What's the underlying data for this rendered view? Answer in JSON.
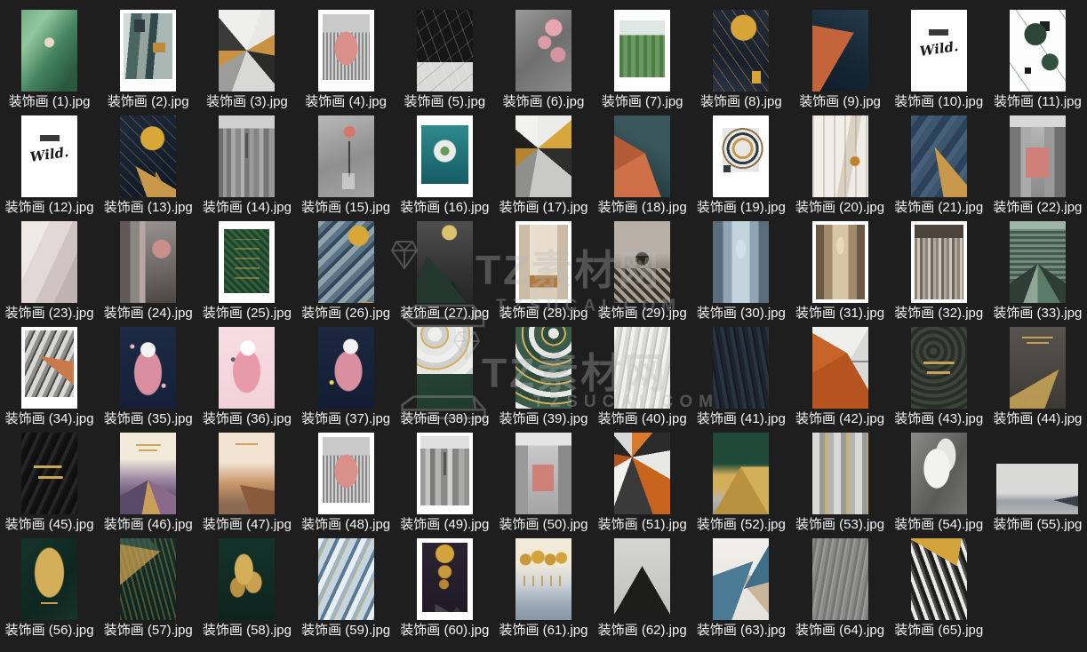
{
  "theme": {
    "background": "#1e1e1e",
    "label_color": "#f5f5f5"
  },
  "watermark": {
    "brand": "TZ素材网",
    "domain": "TZSUCAI.COM"
  },
  "items": [
    {
      "label": "装饰画 (1).jpg",
      "art": "radial-gradient(circle at 50% 40%, #ecd9c8 0 5px, rgba(0,0,0,0) 6px), linear-gradient(125deg,#6fae85,#93c79e 25%,#45845f 55%,#2a5940 85%)"
    },
    {
      "label": "装饰画 (2).jpg",
      "frame": true,
      "pad": "4px 4px 14px 4px",
      "art": "linear-gradient(#c08a3e,#c08a3e) 80% 52%/14px 11px no-repeat, linear-gradient(#2f3b3d,#2f3b3d) 28% 12%/12px 14px no-repeat, linear-gradient(95deg,#d3dbd8 0 14%,#4a6663 14% 34%,#93a49f 34% 50%,#32494b 50% 64%,#a9b8b2 64% 100%)"
    },
    {
      "label": "装饰画 (3).jpg",
      "art": "conic-gradient(from 20deg at 50% 50%, #e8e8e6 0 40deg, #c99142 40deg 80deg, #2b2b29 80deg 120deg, #d8d8d6 120deg 180deg, #9c9c9a 180deg 220deg, #c99142 220deg 250deg, #3a3a38 250deg 300deg, #efefed 300deg 360deg)"
    },
    {
      "label": "装饰画 (4).jpg",
      "frame": true,
      "pad": "5px 5px 13px 5px",
      "art": "radial-gradient(ellipse at 50% 52%, #d98f8a 0 34%, rgba(0,0,0,0) 35%), linear-gradient(#c9c9c9 0 28%, rgba(0,0,0,0) 28%), repeating-linear-gradient(90deg,#8a8a8a 0 2px,#cfcfcf 2px 4px)"
    },
    {
      "label": "装饰画 (5).jpg",
      "art": "repeating-linear-gradient(70deg, rgba(255,255,255,0.22) 0 1px, rgba(0,0,0,0) 1px 12px), repeating-linear-gradient(-40deg, rgba(120,120,120,0.35) 0 1px, rgba(0,0,0,0) 1px 15px), linear-gradient(#161616 0 64%, #dadad8 64%)"
    },
    {
      "label": "装饰画 (6).jpg",
      "art": "radial-gradient(circle at 68% 22%, #e8a7b0 0 9px, rgba(0,0,0,0) 10px), radial-gradient(circle at 52% 40%, #de9aa6 0 7px, rgba(0,0,0,0) 8px), radial-gradient(circle at 76% 55%, #d393a0 0 8px, rgba(0,0,0,0) 9px), linear-gradient(140deg,#9a9a9a,#6f6f6f 50%,#8c8c8c)"
    },
    {
      "label": "装饰画 (7).jpg",
      "frame": true,
      "pad": "12px 6px 16px 6px",
      "art": "linear-gradient(#dfe7e2 0 26%, rgba(0,0,0,0) 26%), repeating-linear-gradient(90deg,#4e7d49 0 4px,#699a5f 4px 9px)"
    },
    {
      "label": "装饰画 (8).jpg",
      "art": "radial-gradient(circle at 55% 22%, #d8a437 0 14px, rgba(0,0,0,0) 15px), linear-gradient(#d8a437,#d8a437) 82% 88%/10px 14px no-repeat, repeating-linear-gradient(55deg, rgba(201,145,66,0.5) 0 1px, rgba(0,0,0,0) 1px 10px), linear-gradient(200deg,#232c3a,#18202c 60%,#2a3446)"
    },
    {
      "label": "装饰画 (9).jpg",
      "art": "conic-gradient(from 210deg at 74% 28%, #c4643a 0 70deg, rgba(0,0,0,0) 70deg), linear-gradient(205deg,#24394a,#152734 55%,#0f1d28)"
    },
    {
      "label": "装饰画 (10).jpg",
      "frame": true,
      "pad": "4px",
      "thumb_text": "Wild.",
      "text_size": 15,
      "art": "linear-gradient(#3a3a3a,#3a3a3a) 50% 24%/40% 7px no-repeat, linear-gradient(#fff,#fff)"
    },
    {
      "label": "装饰画 (11).jpg",
      "art": "radial-gradient(circle at 46% 30%, #2c4538 0 12px, rgba(0,0,0,0) 13px), linear-gradient(#202020,#202020) 66% 16%/11px 11px no-repeat, radial-gradient(circle at 72% 64%, #31503f 0 9px, rgba(0,0,0,0) 10px), linear-gradient(#161616,#161616) 30% 76%/7px 7px no-repeat, repeating-linear-gradient(55deg, rgba(0,0,0,0) 0 18px, #9fb3ab 18px 19px, rgba(0,0,0,0) 19px 40px), linear-gradient(#fdfdfd,#fdfdfd)"
    },
    {
      "label": "装饰画 (12).jpg",
      "frame": true,
      "pad": "4px",
      "thumb_text": "Wild.",
      "text_size": 15,
      "art": "linear-gradient(#3a3a3a,#3a3a3a) 50% 24%/40% 7px no-repeat, linear-gradient(#fff,#fff)"
    },
    {
      "label": "装饰画 (13).jpg",
      "art": "radial-gradient(circle at 58% 28%, #d9a738 0 13px, rgba(0,0,0,0) 14px), conic-gradient(from 120deg at 28% 62%, #c9984a 0 40deg, rgba(0,0,0,0) 40deg), conic-gradient(from 150deg at 64% 68%, #b8863b 0 35deg, rgba(0,0,0,0) 35deg), repeating-linear-gradient(45deg, rgba(201,152,74,0.35) 0 1px, rgba(0,0,0,0) 1px 9px), linear-gradient(150deg,#1d2a3c,#141f2e 60%,#0e1826)"
    },
    {
      "label": "装饰画 (14).jpg",
      "art": "linear-gradient(#555,#555) 50% 32%/3px 28px no-repeat, linear-gradient(#cfcfcf 0 16%, rgba(0,0,0,0) 16%), linear-gradient(90deg,#6e6e6e 0 8%,#999 8% 14%,#777 14% 22%,#a8a8a8 22% 30%,#8a8a8a 30% 40%,#b0b0b0 40% 46%,#787878 46% 55%,#9b9b9b 55% 63%,#858585 63% 72%,#ababab 72% 80%,#757575 80% 90%,#989898 90%)"
    },
    {
      "label": "装饰画 (15).jpg",
      "art": "radial-gradient(circle at 56% 20%, #d4766b 0 6px, rgba(0,0,0,0) 7px), linear-gradient(rgba(255,255,255,0.45),rgba(255,255,255,0.45)) 56% 88%/14px 18px no-repeat, linear-gradient(#3f3f3f,#3f3f3f) 56% 55%/2px 40px no-repeat, linear-gradient(160deg,#b9b9b9,#8f8f8f 55%,#a5a5a5)"
    },
    {
      "label": "装饰画 (16).jpg",
      "frame": true,
      "pad": "11px 5px 15px 5px",
      "art": "radial-gradient(circle at 50% 44%, #6a9a58 0 5px, #e9ece8 5px 12px, rgba(0,0,0,0) 13px), linear-gradient(#2f8a8d,#1f6f74 60%,#175c63)"
    },
    {
      "label": "装饰画 (17).jpg",
      "art": "conic-gradient(from 0deg at 40% 40%, #ececea 0 50deg, #d9a63c 50deg 90deg, #2e2e2c 90deg 130deg, #c9c9c7 130deg 190deg, #8f8f8d 190deg 230deg, #b5842f 230deg 270deg, #1f1f1d 270deg 310deg, #f2f2f0 310deg)"
    },
    {
      "label": "装饰画 (18).jpg",
      "art": "conic-gradient(from 160deg at 55% 46%, #d07048 0 80deg, #b35a36 80deg 140deg, rgba(0,0,0,0) 140deg), linear-gradient(210deg,#3a565b 0 35%,#274247 70%,#1d3338)"
    },
    {
      "label": "装饰画 (19).jpg",
      "frame": true,
      "pad": "5px 5px 14px 5px",
      "art": "radial-gradient(circle at 54% 44%, rgba(0,0,0,0) 0 9px, #c9984a 9px 12px, rgba(0,0,0,0) 12px 15px, #2e3b3c 15px 18px, rgba(0,0,0,0) 18px 21px, #88724a 21px 23px, rgba(0,0,0,0) 23px), linear-gradient(#2e3b3c,#2e3b3c) 14% 78%/8px 8px no-repeat, linear-gradient(rgba(120,120,118,0.18),rgba(120,120,118,0.18)) 50% 40%/78% 68% no-repeat, linear-gradient(#fff,#fff)"
    },
    {
      "label": "装饰画 (20).jpg",
      "art": "radial-gradient(circle at 76% 56%, #c2812f 0 5px, rgba(0,0,0,0) 6px), repeating-linear-gradient(90deg, rgba(150,140,120,0.35) 0 2px, rgba(0,0,0,0) 2px 12px), linear-gradient(100deg,#f2efe9 0 55%,#d9d2c4 55% 70%,#efece6 70%)"
    },
    {
      "label": "装饰画 (21).jpg",
      "art": "conic-gradient(from 140deg at 42% 38%, #c9984a 0 30deg, rgba(0,0,0,0) 30deg), conic-gradient(from 160deg at 70% 76%, #c9984a 0 35deg, rgba(0,0,0,0) 35deg), repeating-linear-gradient(125deg, #3d566e 0 8px, #2c415a 8px 16px, #46607a 16px 22px)"
    },
    {
      "label": "装饰画 (22).jpg",
      "art": "linear-gradient(#d8d8d8 0 14%, rgba(0,0,0,0) 14%), linear-gradient(#cf8079,#cf8079) 50% 62%/26px 34px no-repeat, linear-gradient(90deg,#777 0 20%,#aaa 20% 38%, rgba(0,0,0,0) 38% 62%, #999 62% 80%, #6f6f6f 80%), linear-gradient(#bdbdbd,#8a8a8a)"
    },
    {
      "label": "装饰画 (23).jpg",
      "art": "conic-gradient(from 230deg at 0% 35%, #cd6a42 0 50deg, rgba(0,0,0,0) 50deg), linear-gradient(115deg,#efe9e6 0 30%,#e2d9d6 30% 55%,#cfc4c2 55% 75%,#bfb3b1 75%)"
    },
    {
      "label": "装饰画 (24).jpg",
      "art": "radial-gradient(circle at 74% 34%, #c98f8a 0 10px, rgba(0,0,0,0) 11px), linear-gradient(90deg,#5f5a58 0 18%,#8c8684 18% 35%,#b5a8a4 35% 45%, rgba(0,0,0,0) 45%), linear-gradient(170deg,#9a9492,#6e6866 60%,#4a4644)"
    },
    {
      "label": "装饰画 (25).jpg",
      "frame": true,
      "pad": "9px 6px 11px 6px",
      "art": "repeating-linear-gradient(0deg, rgba(0,0,0,0) 0 6px, rgba(212,175,90,0.85) 6px 7px, rgba(0,0,0,0) 7px 11px) 50% 50%/55% 70% no-repeat, repeating-linear-gradient(45deg, rgba(52,98,62,0.85) 0 3px, rgba(28,62,38,0.85) 3px 6px), linear-gradient(#2f5c3a,#1f4429)"
    },
    {
      "label": "装饰画 (26).jpg",
      "art": "radial-gradient(circle at 72% 18%, #d9a738 0 11px, rgba(0,0,0,0) 12px), conic-gradient(from 95deg at 78% 98%, #c9984a 0 55deg, rgba(0,0,0,0) 55deg), repeating-linear-gradient(135deg, #8fa3ad 0 6px, #5c7485 6px 12px, #32495c 12px 16px)"
    },
    {
      "label": "装饰画 (27).jpg",
      "art": "radial-gradient(circle at 58% 14%, #d9c36a 0 8px, rgba(0,0,0,0) 9px), conic-gradient(from 140deg at 18% 42%, #24382f 0 60deg, rgba(0,0,0,0) 60deg), conic-gradient(from 150deg at 65% 72%, #1d2d26 0 70deg, rgba(0,0,0,0) 70deg), linear-gradient(#4f4f4f,#333333 60%,#262626)"
    },
    {
      "label": "装饰画 (28).jpg",
      "frame": true,
      "pad": "4px",
      "art": "radial-gradient(ellipse at 50% 18%, #e8ddcc 0 28%, rgba(0,0,0,0) 29%), linear-gradient(90deg,#c9bba6 0 22%, rgba(0,0,0,0) 22% 78%, #c9bba6 78%), linear-gradient(#e8dfcf 0 68%, #b07a3f 68% 84%, #d8cdbb 84%)"
    },
    {
      "label": "装饰画 (29).jpg",
      "art": "radial-gradient(circle at 50% 46%, #2b2620 0 7px, rgba(0,0,0,0) 8px), repeating-linear-gradient(45deg,#3a342c 0 4px,#a89f93 4px 8px) 0 100%/100% 42% no-repeat, linear-gradient(#b8b0a6 0 40%, #8f877c 58%, #6b645a)"
    },
    {
      "label": "装饰画 (30).jpg",
      "art": "radial-gradient(ellipse at 50% 34%, #cfe0ea 0 12%, rgba(0,0,0,0) 13%), linear-gradient(90deg,#5a6d7c 0 18%,#8fa5b5 18% 34%,#c3d4df 34% 66%,#8fa5b5 66% 82%,#5a6d7c 82%), linear-gradient(#7c93a5,#4a5d6c)"
    },
    {
      "label": "装饰画 (31).jpg",
      "frame": true,
      "pad": "4px",
      "art": "radial-gradient(ellipse at 50% 28%, #e8d9b8 0 11%, rgba(0,0,0,0) 12%), linear-gradient(90deg,#6b5844 0 16%,#a08a6a 16% 34%,#d8c6a2 34% 66%,#a08a6a 66% 84%,#6b5844 84%), linear-gradient(#b59d79 0 70%, #8a6f4e 70%)"
    },
    {
      "label": "装饰画 (32).jpg",
      "frame": true,
      "pad": "4px",
      "art": "linear-gradient(#4a443c,#4a443c) 0 0/100% 18% no-repeat, repeating-linear-gradient(90deg,#8a8478 0 3px,#cfc8ba 3px 6px,#6e675c 6px 9px,#b0a99b 9px 12px), linear-gradient(#7a7368,#55504a)"
    },
    {
      "label": "装饰画 (33).jpg",
      "art": "linear-gradient(#9fb5a8 0 10%, rgba(0,0,0,0) 10%), conic-gradient(from 125deg at 50% 52%, #2e3d36 0 25deg, #5a7a6a 25deg 55deg, #8fa698 55deg 75deg, #2e3d36 75deg 110deg, rgba(0,0,0,0) 110deg), repeating-linear-gradient(0deg,#44584e 0 3px,#718c7e 3px 6px)"
    },
    {
      "label": "装饰画 (34).jpg",
      "frame": true,
      "pad": "4px 4px 13px 4px",
      "art": "conic-gradient(from 100deg at 28% 38%, #c97a4a 0 30deg, rgba(0,0,0,0) 30deg), repeating-linear-gradient(115deg,#d8d8d6 0 5px,#8f8f8d 5px 9px,#4a4a48 9px 11px)"
    },
    {
      "label": "装饰画 (35).jpg",
      "art": "radial-gradient(circle at 50% 28%, #f2f2f0 0 8px, rgba(0,0,0,0) 9px), radial-gradient(ellipse at 50% 56%, #d98fa0 0 15px, rgba(0,0,0,0) 16px), radial-gradient(circle at 22% 24%, #e8b8c2 0 2px, rgba(0,0,0,0) 3px), radial-gradient(circle at 78% 72%, #e8b8c2 0 2px, rgba(0,0,0,0) 3px), linear-gradient(#1d2a44,#15203a)"
    },
    {
      "label": "装饰画 (36).jpg",
      "art": "radial-gradient(circle at 52% 26%, #ffffff 0 8px, rgba(0,0,0,0) 9px), radial-gradient(ellipse at 50% 54%, #e89aab 0 15px, rgba(0,0,0,0) 16px), radial-gradient(circle at 26% 40%, #5a5a6a 0 2px, rgba(0,0,0,0) 3px), linear-gradient(#f6dde3,#f2d2da)"
    },
    {
      "label": "装饰画 (37).jpg",
      "art": "radial-gradient(circle at 58% 24%, #f2f2f0 0 8px, rgba(0,0,0,0) 9px), radial-gradient(ellipse at 54% 54%, #d98fa0 0 15px, rgba(0,0,0,0) 16px), radial-gradient(circle at 24% 68%, #e8d85a 0 2px, rgba(0,0,0,0) 3px), linear-gradient(#1b2840,#121d33)"
    },
    {
      "label": "装饰画 (38).jpg",
      "art": "repeating-radial-gradient(circle at 32% 16%, #eeeeec 0 8px, #cfcfcd 8px 14px, #d4af5a 14px 16px, #e5e5e3 16px 24px) 0 0/100% 58% no-repeat, linear-gradient(170deg,#2e4a3c,#1f3a2e)"
    },
    {
      "label": "装饰画 (39).jpg",
      "art": "repeating-radial-gradient(circle at 68% 8%, #e8e8e6 0 6px, #2e4a3c 6px 12px, #d4af5a 12px 14px, #3a5a4a 14px 22px), linear-gradient(#27453a,#1d392e)"
    },
    {
      "label": "装饰画 (40).jpg",
      "art": "repeating-linear-gradient(100deg,#f2f2f0 0 4px,#d9d9d7 4px 8px,#c5c5c3 8px 10px), linear-gradient(#e8e8e6,#cfcfcd)"
    },
    {
      "label": "装饰画 (41).jpg",
      "art": "repeating-linear-gradient(80deg,#1d242e 0 4px,#2a3340 4px 8px,#141a22 8px 10px), linear-gradient(#1a212b,#10151d)"
    },
    {
      "label": "装饰画 (42).jpg",
      "art": "conic-gradient(from 150deg at 62% 32%, #b5541f 0 90deg, #c86428 90deg 150deg, rgba(0,0,0,0) 150deg), linear-gradient(#8a8a88,#8a8a88) 0 42%/100% 2px no-repeat, linear-gradient(120deg,#efefed 0 55%,#d9d9d7 55%)"
    },
    {
      "label": "装饰画 (43).jpg",
      "art": "linear-gradient(rgba(212,175,90,0.9),rgba(212,175,90,0.9)) 50% 44%/55% 3px no-repeat, linear-gradient(rgba(212,175,90,0.9),rgba(212,175,90,0.9)) 50% 56%/42% 3px no-repeat, repeating-radial-gradient(circle at 40% 30%, #3c443c 0 4px, #262e26 4px 8px), linear-gradient(#2e362e,#1f261f)"
    },
    {
      "label": "装饰画 (44).jpg",
      "art": "linear-gradient(#c9a050,#c9a050) 50% 12%/55% 2px no-repeat, linear-gradient(#c9a050,#c9a050) 50% 19%/40% 2px no-repeat, conic-gradient(from 200deg at 88% 52%, rgba(212,175,90,0.8) 0 40deg, rgba(0,0,0,0) 40deg), conic-gradient(from 160deg at 28% 88%, rgba(58,56,52,0.95) 0 50deg, rgba(0,0,0,0) 50deg), linear-gradient(#57534e,#3d3a36)"
    },
    {
      "label": "装饰画 (45).jpg",
      "art": "linear-gradient(rgba(212,175,90,0.95),rgba(212,175,90,0.95)) 45% 42%/50% 3px no-repeat, linear-gradient(rgba(212,175,90,0.95),rgba(212,175,90,0.95)) 55% 55%/44% 3px no-repeat, repeating-linear-gradient(115deg,#0f0f0f 0 5px,#262626 5px 9px,#141414 9px 12px)"
    },
    {
      "label": "装饰画 (46).jpg",
      "art": "linear-gradient(rgba(201,160,80,0.9),rgba(201,160,80,0.9)) 50% 14%/45% 2px no-repeat, linear-gradient(rgba(201,160,80,0.9),rgba(201,160,80,0.9)) 50% 21%/34% 2px no-repeat, conic-gradient(from 120deg at 50% 58%, #8a6a8a 0 40deg, #c9a05a 40deg 70deg, #5a4a6a 70deg 120deg, rgba(0,0,0,0) 120deg), linear-gradient(#f2ead8 0 32%, #9a86a0 58%, #4a3c58 88%)"
    },
    {
      "label": "装饰画 (47).jpg",
      "art": "linear-gradient(rgba(201,160,80,0.9),rgba(201,160,80,0.9)) 50% 13%/40% 2px no-repeat, conic-gradient(from 100deg at 38% 64%, #8a5a3c 0 60deg, rgba(0,0,0,0) 60deg), linear-gradient(#f2e3d2 0 36%, #c9976a 62%, #8a6a52 88%)"
    },
    {
      "label": "装饰画 (48).jpg",
      "frame": true,
      "pad": "5px 5px 13px 5px",
      "art": "radial-gradient(ellipse at 50% 52%, #d98f8a 0 34%, rgba(0,0,0,0) 35%), linear-gradient(#c9c9c9 0 28%, rgba(0,0,0,0) 28%), repeating-linear-gradient(90deg,#8a8a8a 0 2px,#cfcfcf 2px 4px)"
    },
    {
      "label": "装饰画 (49).jpg",
      "frame": true,
      "pad": "4px 4px 10px 4px",
      "art": "linear-gradient(#555,#555) 50% 34%/3px 26px no-repeat, linear-gradient(#e0e0e0 0 18%, rgba(0,0,0,0) 18%), linear-gradient(90deg,#9a9a98 0 10%,#c5c5c3 10% 20%,#7a7a78 20% 30%,#b5b5b3 30% 42%,#8a8a88 42% 55%,#cfcfcd 55% 65%,#858583 65% 78%,#aaaaa8 78% 90%,#92928f 90%)"
    },
    {
      "label": "装饰画 (50).jpg",
      "art": "linear-gradient(#e5e5e5 0 16%, rgba(0,0,0,0) 16%), linear-gradient(#cf8079,#cf8079) 50% 58%/24px 30px no-repeat, linear-gradient(90deg,#9a9a9a 0 22%, rgba(0,0,0,0) 22% 76%, #8a8a8a 76%), linear-gradient(#cfcfcf,#a5a5a5)"
    },
    {
      "label": "装饰画 (51).jpg",
      "art": "conic-gradient(from 0deg at 32% 30%, #d97a2a 0 40deg, #2b2b2b 40deg 80deg, #e8e8e6 80deg 120deg, #c9641f 120deg 160deg, #3a3a3a 160deg 200deg, #f2f2f0 200deg 240deg, #b5541f 240deg 280deg, #242424 280deg 320deg, #d9d9d7 320deg)"
    },
    {
      "label": "装饰画 (52).jpg",
      "art": "conic-gradient(from 90deg at 50% 42%, #d4af5a 0 60deg, #b8923e 60deg 120deg, rgba(0,0,0,0) 120deg), linear-gradient(#1f4a3a 0 38%, #d4af5a 52% 68%, #b5b5b3 82%, #9a9a98)"
    },
    {
      "label": "装饰画 (53).jpg",
      "art": "repeating-linear-gradient(90deg,#d9d9d7 0 8px,#9a9a98 8px 14px,#cbb36a 14px 17px,#b5b5b3 17px 24px), linear-gradient(#c5c5c3,#a5a5a3)"
    },
    {
      "label": "装饰画 (54).jpg",
      "art": "radial-gradient(ellipse at 46% 44%, #f2f2f0 0 30%, rgba(0,0,0,0) 31%), radial-gradient(ellipse at 62% 28%, #e5e5e3 0 20%, rgba(0,0,0,0) 21%), linear-gradient(120deg,#8a8a88,#5a5a58 60%,#757573)"
    },
    {
      "label": "装饰画 (55).jpg",
      "w": 92,
      "h": 57,
      "art": "conic-gradient(from 80deg at 70% 72%, #3a3f4a 0 25deg, rgba(0,0,0,0) 25deg), linear-gradient(#d9d9d7 0 58%, #9aa0a8 74%, #b5b5b3)"
    },
    {
      "label": "装饰画 (56).jpg",
      "art": "radial-gradient(ellipse at 50% 42%, #d4af5a 0 16px, rgba(0,0,0,0) 17px), linear-gradient(#c9a050,#c9a050) 50% 80%/30% 2px no-repeat, linear-gradient(135deg,#16332a,#0e2620 60%,#16332a)"
    },
    {
      "label": "装饰画 (57).jpg",
      "art": "conic-gradient(from 230deg at 72% 16%, rgba(201,160,80,0.75) 0 50deg, rgba(58,90,74,0.8) 50deg 90deg, rgba(0,0,0,0) 90deg), repeating-linear-gradient(75deg, rgba(201,160,80,0.35) 0 2px, rgba(0,0,0,0) 2px 6px), linear-gradient(#123029,#0b241e)"
    },
    {
      "label": "装饰画 (58).jpg",
      "art": "radial-gradient(ellipse at 45% 38%, #d4af5a 0 10px, rgba(0,0,0,0) 11px), radial-gradient(ellipse at 62% 54%, #c9a050 0 9px, rgba(0,0,0,0) 10px), radial-gradient(ellipse at 34% 60%, #b8923e 0 8px, rgba(0,0,0,0) 9px), linear-gradient(#14332b,#0c241d)"
    },
    {
      "label": "装饰画 (59).jpg",
      "art": "repeating-linear-gradient(115deg,#e8eef2 0 6px,#9ab5c9 6px 10px,#d4af5a 10px 11px,#c5d5e0 11px 18px,#5a7a94 18px 22px), linear-gradient(#cfdde8,#8aa5ba)"
    },
    {
      "label": "装饰画 (60).jpg",
      "frame": true,
      "pad": "5px 6px 9px 6px",
      "art": "radial-gradient(circle at 50% 16%, #d4a43c 0 10px, rgba(0,0,0,0) 11px), radial-gradient(circle at 50% 42%, #c9983a 0 7px, rgba(0,0,0,0) 8px), radial-gradient(circle at 48% 60%, #b8862f 0 5px, rgba(0,0,0,0) 6px), conic-gradient(from 120deg at 28% 88%, #4a4048 0 60deg, rgba(0,0,0,0) 60deg), conic-gradient(from 140deg at 76% 92%, #3a323a 0 70deg, rgba(0,0,0,0) 70deg), linear-gradient(#2b2430,#201a26)"
    },
    {
      "label": "装饰画 (61).jpg",
      "art": "radial-gradient(circle at 18% 26%, #c9983a 0 6px, rgba(0,0,0,0) 7px), radial-gradient(circle at 40% 23%, #d4a43c 0 7px, rgba(0,0,0,0) 8px), radial-gradient(circle at 62% 26%, #c9983a 0 6px, rgba(0,0,0,0) 7px), radial-gradient(circle at 82% 24%, #d4a43c 0 6px, rgba(0,0,0,0) 7px), repeating-linear-gradient(90deg, rgba(201,152,58,0.8) 0 2px, rgba(0,0,0,0) 2px 10px) 50% 52%/70% 12px no-repeat, linear-gradient(#f2ead8 0 30%, #cfd5da 55%, #9aa8b5 82%, #8a98a5)"
    },
    {
      "label": "装饰画 (62).jpg",
      "art": "conic-gradient(from 150deg at 50% 34%, #1d1d1b 0 60deg, rgba(0,0,0,0) 60deg), conic-gradient(from 148deg at 50% 46%, #d4af5a 0 62deg, rgba(0,0,0,0) 62deg), conic-gradient(from 146deg at 50% 58%, #3a3a38 0 64deg, rgba(0,0,0,0) 64deg), linear-gradient(#d5d5d3,#c0c0be)"
    },
    {
      "label": "装饰画 (63).jpg",
      "art": "conic-gradient(from 200deg at 72% 28%, #4a7a94 0 50deg, rgba(0,0,0,0) 50deg), conic-gradient(from 30deg at 55% 62%, #3f6f88 0 45deg, rgba(0,0,0,0) 45deg), conic-gradient(from 100deg at 38% 42%, #c9b59a 0 40deg, rgba(0,0,0,0) 40deg), linear-gradient(#f2f0ec,#e5e2dc)"
    },
    {
      "label": "装饰画 (64).jpg",
      "art": "repeating-linear-gradient(100deg,#8a8a88 0 3px,#757573 3px 6px,#9a9a98 6px 8px), linear-gradient(#858583,#6e6e6c)"
    },
    {
      "label": "装饰画 (65).jpg",
      "art": "conic-gradient(from 300deg at 82% 34%, #d4a43c 0 70deg, rgba(0,0,0,0) 70deg), repeating-linear-gradient(70deg,#1d1d1b 0 4px,#e8e8e6 4px 8px,#4a4a48 8px 11px), linear-gradient(#d9d9d7,#b5b5b3)"
    }
  ]
}
